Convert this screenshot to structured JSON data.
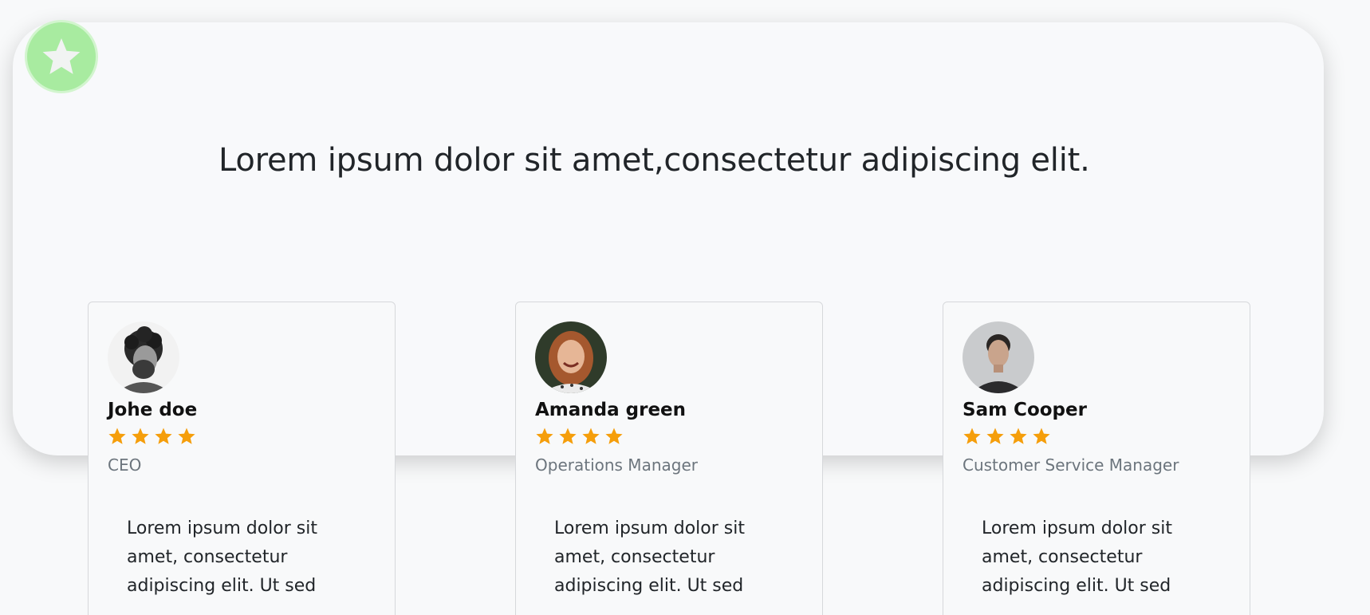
{
  "hero": {
    "badge_icon": "star-icon",
    "headline": "Lorem ipsum dolor sit amet,consectetur adipiscing elit."
  },
  "colors": {
    "star": "#f59e0b",
    "badge": "#a8eba0"
  },
  "testimonials": [
    {
      "name": "Johe doe",
      "rating": 4,
      "role": "CEO",
      "quote": "Lorem ipsum dolor sit amet, consectetur adipiscing elit. Ut sed"
    },
    {
      "name": "Amanda green",
      "rating": 4,
      "role": "Operations Manager",
      "quote": "Lorem ipsum dolor sit amet, consectetur adipiscing elit. Ut sed"
    },
    {
      "name": "Sam Cooper",
      "rating": 4,
      "role": "Customer Service Manager",
      "quote": "Lorem ipsum dolor sit amet, consectetur adipiscing elit. Ut sed"
    }
  ]
}
